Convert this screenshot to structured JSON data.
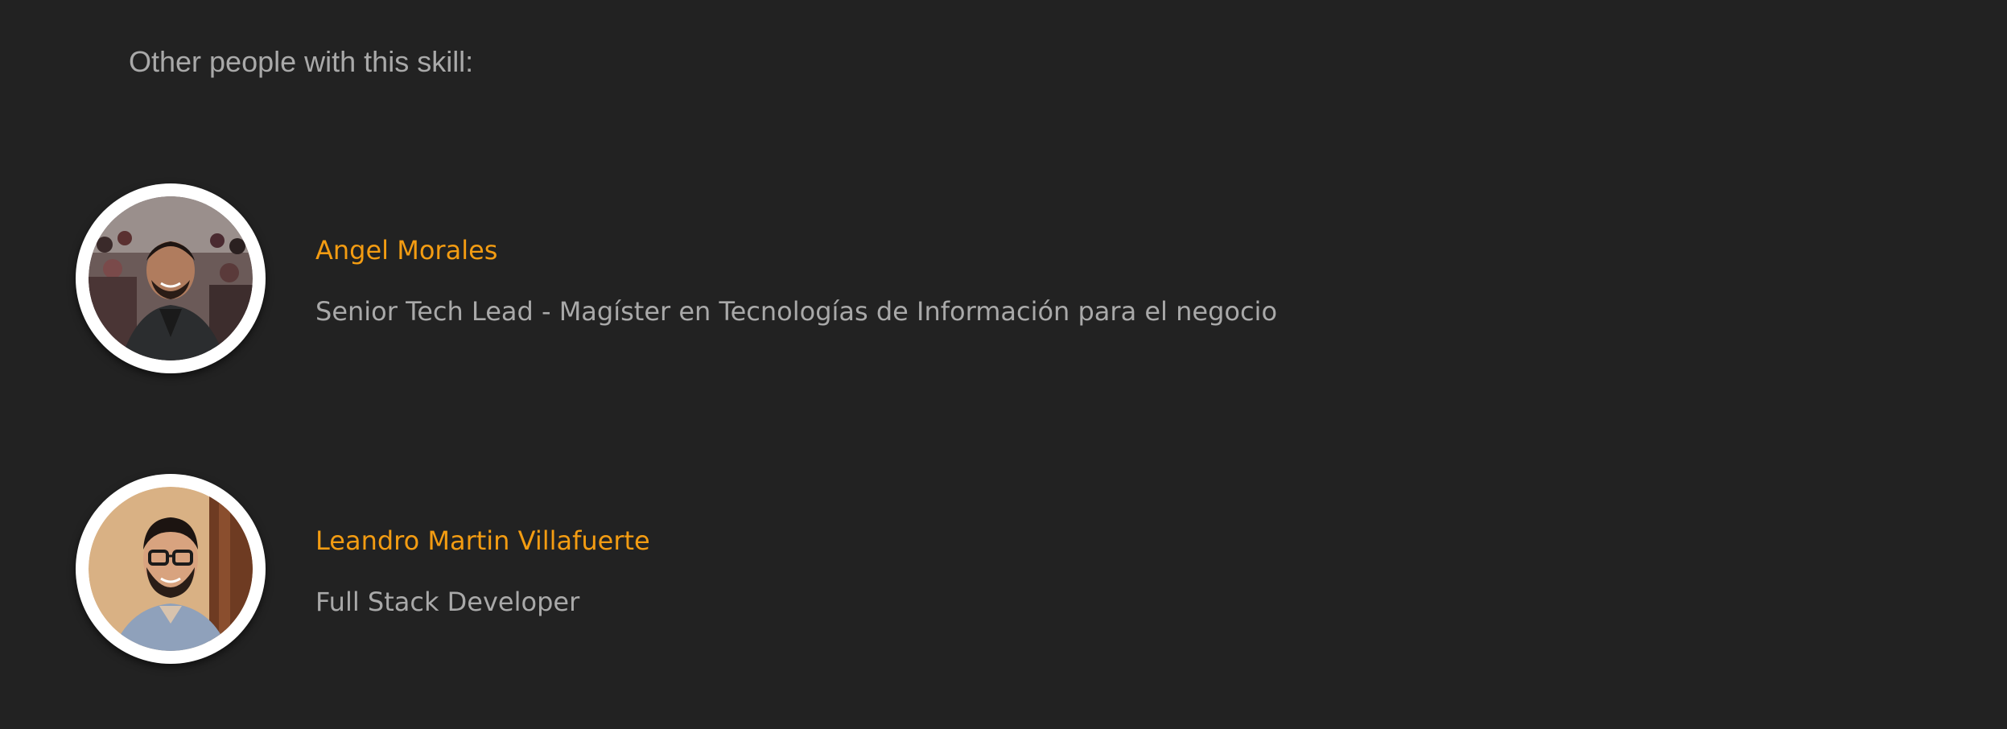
{
  "section": {
    "title": "Other people with this skill:"
  },
  "people": [
    {
      "name": "Angel Morales",
      "role": "Senior Tech Lead - Magíster en Tecnologías de Información para el negocio",
      "avatar_icon": "avatar-photo-angel-morales"
    },
    {
      "name": "Leandro Martin Villafuerte",
      "role": "Full Stack Developer",
      "avatar_icon": "avatar-photo-leandro-martin-villafuerte"
    }
  ],
  "colors": {
    "background": "#222222",
    "name_link": "#f39c12",
    "muted_text": "#a9a9a9",
    "avatar_ring": "#ffffff"
  }
}
